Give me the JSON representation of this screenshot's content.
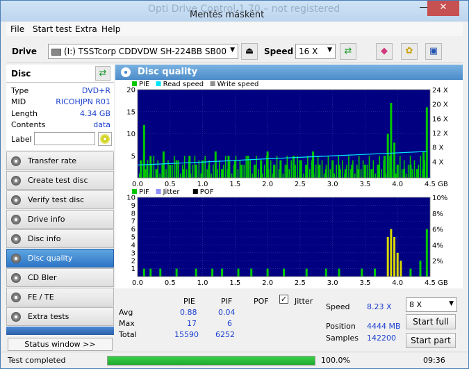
{
  "window": {
    "ghost_title": "Opti Drive Control 1.70 – not registered",
    "title": "Mentés másként",
    "minimize": "—",
    "close": "✕"
  },
  "menu": [
    "File",
    "Start test",
    "Extra",
    "Help"
  ],
  "toolbar": {
    "drive_label": "Drive",
    "drive_value": "(I:)  TSSTcorp CDDVDW SH-224BB SB00",
    "speed_label": "Speed",
    "speed_value": "16 X"
  },
  "disc": {
    "header": "Disc",
    "type_k": "Type",
    "type_v": "DVD+R",
    "mid_k": "MID",
    "mid_v": "RICOHJPN R01",
    "length_k": "Length",
    "length_v": "4.34 GB",
    "contents_k": "Contents",
    "contents_v": "data",
    "label_k": "Label"
  },
  "nav": [
    "Transfer rate",
    "Create test disc",
    "Verify test disc",
    "Drive info",
    "Disc info",
    "Disc quality",
    "CD Bler",
    "FE / TE",
    "Extra tests"
  ],
  "status_window": "Status window >>",
  "main": {
    "title": "Disc quality"
  },
  "chart_data": [
    {
      "type": "bar",
      "legend": [
        "PIE",
        "Read speed",
        "Write speed"
      ],
      "x_ticks": [
        "0.0",
        "0.5",
        "1.0",
        "1.5",
        "2.0",
        "2.5",
        "3.0",
        "3.5",
        "4.0",
        "4.5 GB"
      ],
      "y_ticks": [
        "20",
        "15",
        "10",
        "5"
      ],
      "y2_ticks": [
        "24 X",
        "20 X",
        "16 X",
        "12 X",
        "8 X",
        "4 X"
      ],
      "xlim": [
        0,
        4.5
      ],
      "ylim": [
        0,
        20
      ],
      "colors": {
        "pie": "#00c800",
        "read": "#00e5ff",
        "bg": "#000080"
      },
      "pie_profile": [
        [
          0.05,
          4
        ],
        [
          0.1,
          12
        ],
        [
          0.15,
          3
        ],
        [
          0.2,
          5
        ],
        [
          0.3,
          2
        ],
        [
          0.4,
          6
        ],
        [
          0.5,
          3
        ],
        [
          0.6,
          4
        ],
        [
          0.7,
          2
        ],
        [
          0.8,
          5
        ],
        [
          0.9,
          3
        ],
        [
          1.0,
          4
        ],
        [
          1.1,
          3
        ],
        [
          1.2,
          6
        ],
        [
          1.3,
          2
        ],
        [
          1.4,
          5
        ],
        [
          1.5,
          4
        ],
        [
          1.6,
          3
        ],
        [
          1.7,
          5
        ],
        [
          1.8,
          3
        ],
        [
          1.9,
          4
        ],
        [
          2.0,
          6
        ],
        [
          2.1,
          3
        ],
        [
          2.2,
          4
        ],
        [
          2.3,
          3
        ],
        [
          2.4,
          5
        ],
        [
          2.5,
          4
        ],
        [
          2.6,
          3
        ],
        [
          2.7,
          6
        ],
        [
          2.8,
          3
        ],
        [
          2.9,
          2
        ],
        [
          3.0,
          4
        ],
        [
          3.1,
          3
        ],
        [
          3.2,
          2
        ],
        [
          3.3,
          3
        ],
        [
          3.4,
          2
        ],
        [
          3.5,
          3
        ],
        [
          3.6,
          2
        ],
        [
          3.7,
          3
        ],
        [
          3.8,
          5
        ],
        [
          3.85,
          10
        ],
        [
          3.9,
          17
        ],
        [
          3.95,
          8
        ],
        [
          4.0,
          3
        ],
        [
          4.1,
          2
        ],
        [
          4.2,
          3
        ],
        [
          4.3,
          2
        ],
        [
          4.4,
          6
        ],
        [
          4.45,
          16
        ]
      ],
      "read_speed": [
        [
          0.0,
          3.5
        ],
        [
          1.0,
          4.3
        ],
        [
          2.0,
          5.2
        ],
        [
          3.0,
          6.0
        ],
        [
          4.0,
          6.8
        ],
        [
          4.45,
          7.2
        ]
      ]
    },
    {
      "type": "bar",
      "legend": [
        "PIF",
        "Jitter",
        "POF"
      ],
      "x_ticks": [
        "0.0",
        "0.5",
        "1.0",
        "1.5",
        "2.0",
        "2.5",
        "3.0",
        "3.5",
        "4.0",
        "4.5 GB"
      ],
      "y_ticks": [
        "10",
        "9",
        "8",
        "7",
        "6",
        "5",
        "4",
        "3",
        "2",
        "1"
      ],
      "y2_ticks": [
        "10%",
        "8%",
        "6%",
        "4%",
        "2%"
      ],
      "xlim": [
        0,
        4.5
      ],
      "ylim": [
        0,
        10
      ],
      "colors": {
        "pif": "#00c800",
        "pif_hi": "#d8d800"
      },
      "pif_profile": [
        [
          0.1,
          1
        ],
        [
          0.2,
          1
        ],
        [
          0.35,
          1
        ],
        [
          0.6,
          1
        ],
        [
          0.9,
          1
        ],
        [
          1.15,
          1
        ],
        [
          1.3,
          1
        ],
        [
          1.55,
          1
        ],
        [
          1.75,
          1
        ],
        [
          2.0,
          1
        ],
        [
          2.25,
          1
        ],
        [
          2.6,
          1
        ],
        [
          2.9,
          1
        ],
        [
          3.1,
          1
        ],
        [
          3.45,
          1
        ],
        [
          3.65,
          1
        ],
        [
          3.85,
          5
        ],
        [
          3.9,
          6
        ],
        [
          3.95,
          5
        ],
        [
          4.0,
          3
        ],
        [
          4.05,
          2
        ],
        [
          4.2,
          1
        ],
        [
          4.35,
          2
        ],
        [
          4.45,
          6
        ]
      ]
    }
  ],
  "stats": {
    "col_pie": "PIE",
    "col_pif": "PIF",
    "col_pof": "POF",
    "col_jitter": "Jitter",
    "avg_label": "Avg",
    "avg_pie": "0.88",
    "avg_pif": "0.04",
    "max_label": "Max",
    "max_pie": "17",
    "max_pif": "6",
    "total_label": "Total",
    "total_pie": "15590",
    "total_pif": "6252",
    "speed_label": "Speed",
    "speed_value": "8.23 X",
    "position_label": "Position",
    "position_value": "4444 MB",
    "samples_label": "Samples",
    "samples_value": "142200",
    "speed_select": "8 X",
    "start_full": "Start full",
    "start_part": "Start part"
  },
  "status": {
    "text": "Test completed",
    "progress_pct": 100,
    "progress_text": "100.0%",
    "time": "09:36"
  }
}
